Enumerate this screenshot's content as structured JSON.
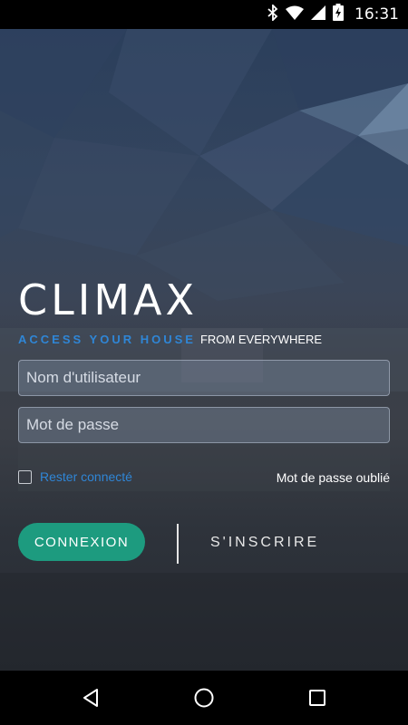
{
  "status_bar": {
    "time": "16:31",
    "icons": [
      "bluetooth-icon",
      "wifi-icon",
      "cellular-signal-icon",
      "battery-charging-icon"
    ]
  },
  "login": {
    "logo": "CLIMAX",
    "tagline_accent": "ACCESS YOUR HOUSE",
    "tagline_rest": "FROM EVERYWHERE",
    "username_placeholder": "Nom d'utilisateur",
    "password_placeholder": "Mot de passe",
    "remember_label": "Rester connecté",
    "remember_checked": false,
    "forgot_password": "Mot de passe oublié",
    "login_button": "CONNEXION",
    "register_button": "S'INSCRIRE"
  },
  "nav_bar": {
    "icons": [
      "back-icon",
      "home-icon",
      "recents-icon"
    ]
  },
  "colors": {
    "accent_blue": "#2f86d6",
    "login_green": "#1d9b7f",
    "background_top": "#2b3f5c",
    "background_bottom": "#262a31"
  }
}
